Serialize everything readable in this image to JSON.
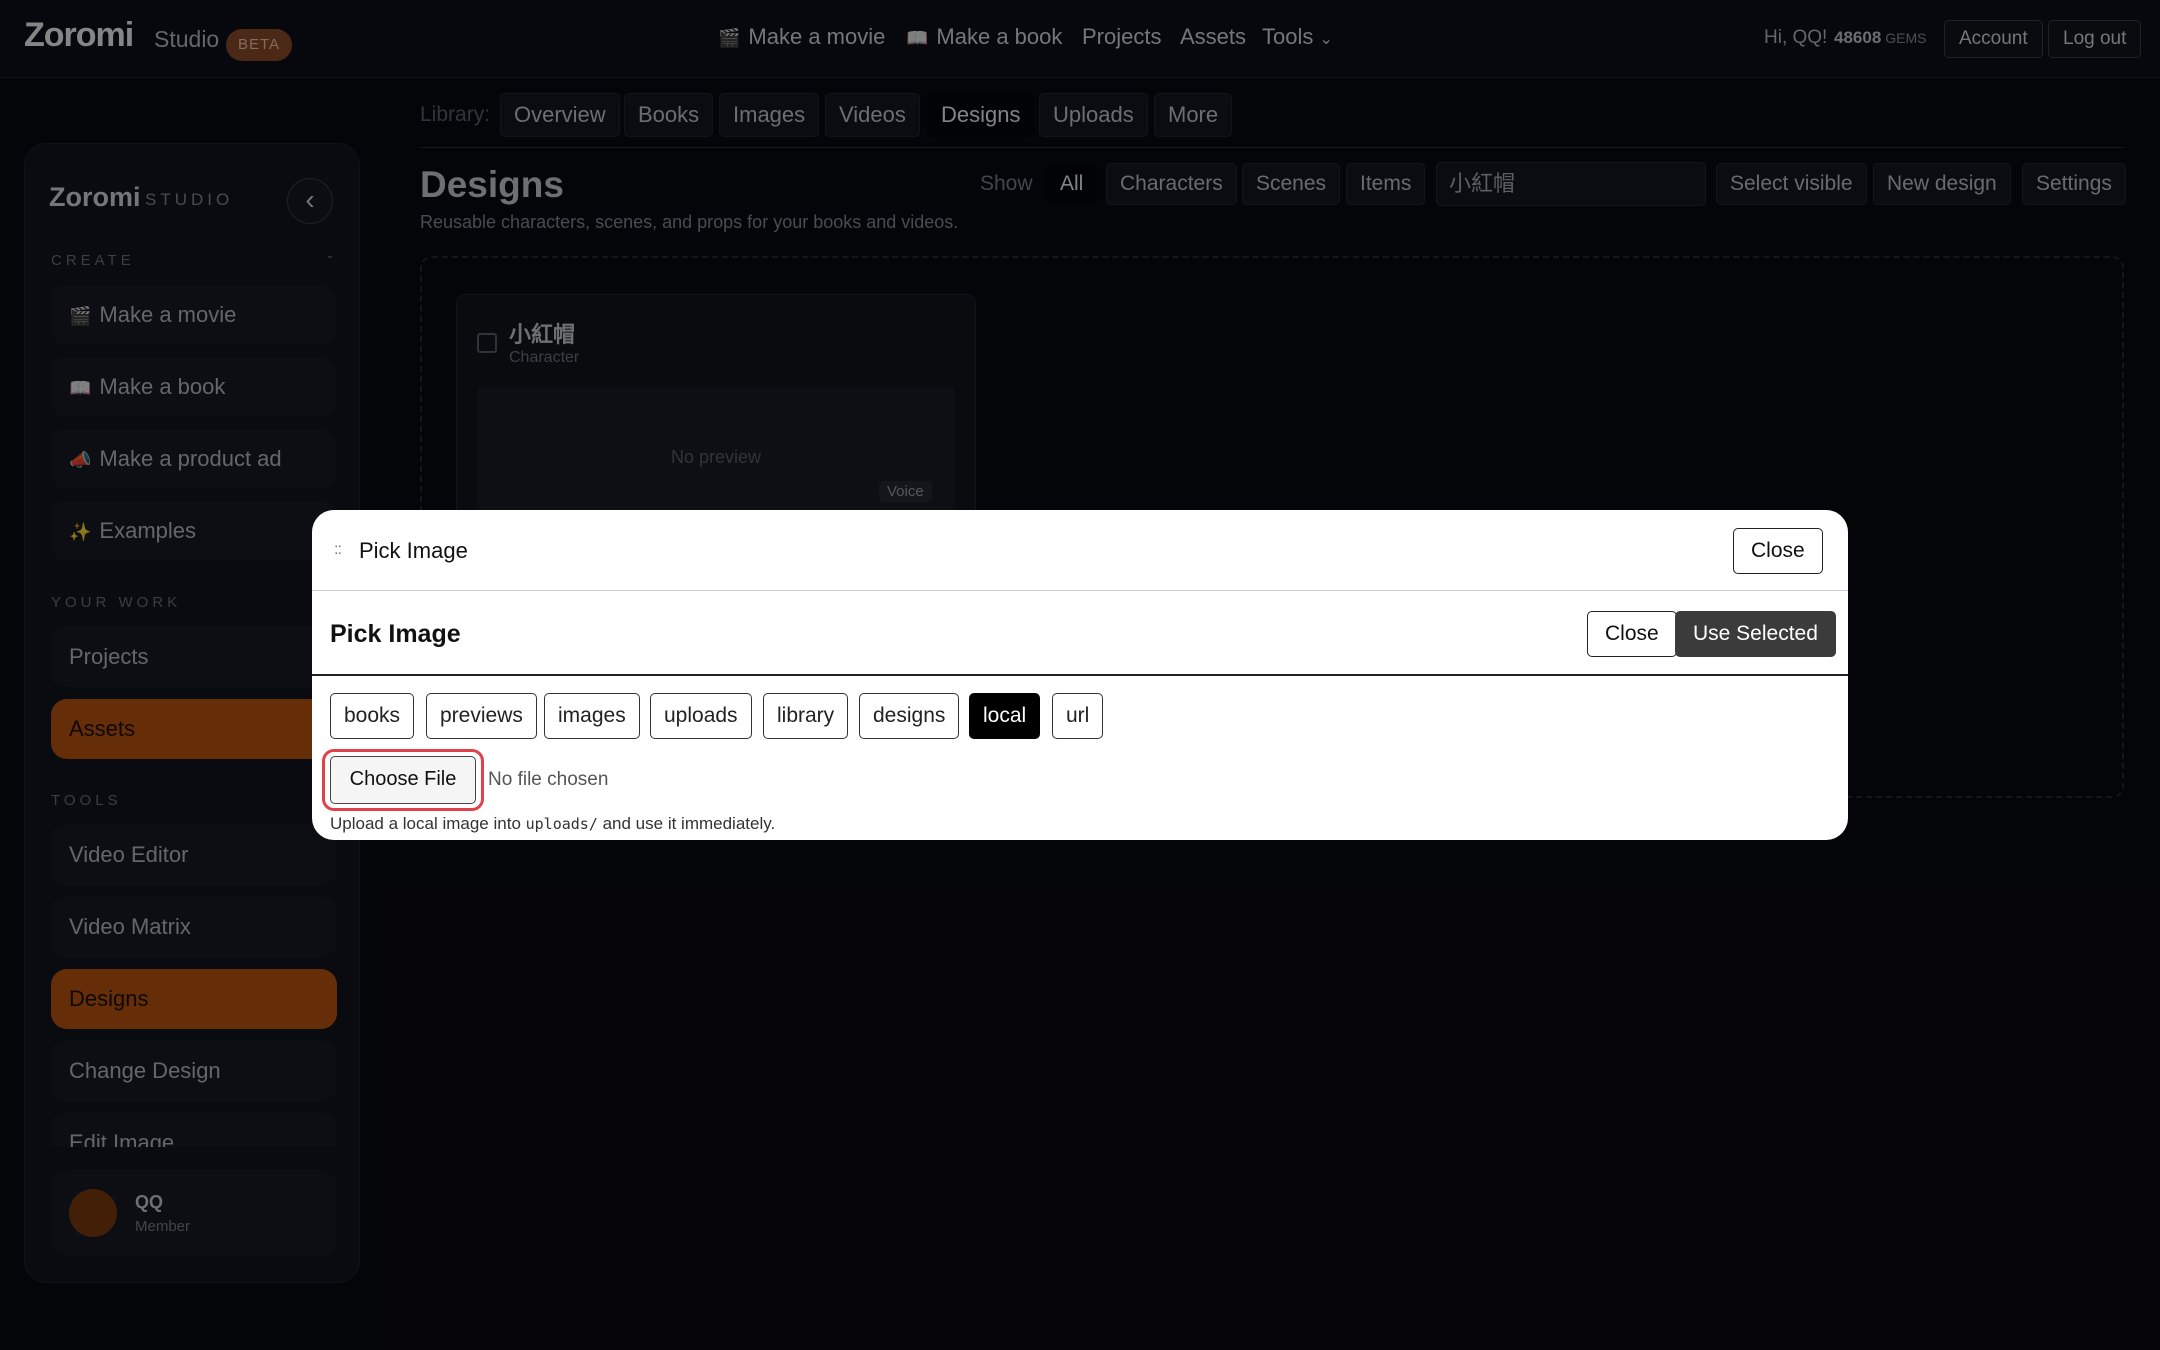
{
  "topbar": {
    "logo": "Zoromi",
    "logo_sub": "Studio",
    "badge": "BETA",
    "nav": [
      {
        "icon": "🎬",
        "icon_name": "clapper-icon",
        "label": "Make a movie"
      },
      {
        "icon": "📖",
        "icon_name": "book-icon",
        "label": "Make a book"
      },
      {
        "label": "Projects"
      },
      {
        "label": "Assets"
      },
      {
        "label": "Tools",
        "caret": "⌄"
      }
    ],
    "greeting": "Hi, QQ!",
    "gems_value": "48608",
    "gems_unit": "GEMS",
    "account": "Account",
    "logout": "Log out"
  },
  "library": {
    "label": "Library:",
    "tabs": [
      "Overview",
      "Books",
      "Images",
      "Videos",
      "Designs",
      "Uploads",
      "More"
    ],
    "active": "Designs"
  },
  "sidebar": {
    "logo": "Zoromi",
    "logo_sub": "STUDIO",
    "collapse_icon": "‹",
    "create_label": "CREATE",
    "create_toggle": "-",
    "create_items": [
      {
        "icon": "🎬",
        "label": "Make a movie"
      },
      {
        "icon": "📖",
        "label": "Make a book"
      },
      {
        "icon": "📣",
        "label": "Make a product ad"
      },
      {
        "icon": "✨",
        "label": "Examples"
      }
    ],
    "work_label": "YOUR WORK",
    "work_items": [
      "Projects",
      "Assets"
    ],
    "tools_label": "TOOLS",
    "tools_items": [
      "Video Editor",
      "Video Matrix",
      "Designs",
      "Change Design",
      "Edit Image"
    ],
    "user_name": "QQ",
    "user_role": "Member",
    "accent": "#b8520f"
  },
  "main": {
    "title": "Designs",
    "description": "Reusable characters, scenes, and props for your books and videos.",
    "show_label": "Show",
    "filters": [
      "All",
      "Characters",
      "Scenes",
      "Items"
    ],
    "active_filter": "All",
    "search_value": "小紅帽",
    "select_visible": "Select visible",
    "new_design": "New design",
    "settings": "Settings",
    "card": {
      "title": "小紅帽",
      "type": "Character",
      "preview": "No preview",
      "badge": "Voice"
    }
  },
  "modal": {
    "title": "Pick Image",
    "drag_icon": "::",
    "close_top": "Close",
    "subtitle": "Pick Image",
    "close": "Close",
    "use_selected": "Use Selected",
    "sources": [
      "books",
      "previews",
      "images",
      "uploads",
      "library",
      "designs",
      "local",
      "url"
    ],
    "active_source": "local",
    "choose_file": "Choose File",
    "no_file": "No file chosen",
    "hint_before": "Upload a local image into ",
    "hint_code": "uploads/",
    "hint_after": " and use it immediately.",
    "highlight_color": "#e0424a"
  }
}
